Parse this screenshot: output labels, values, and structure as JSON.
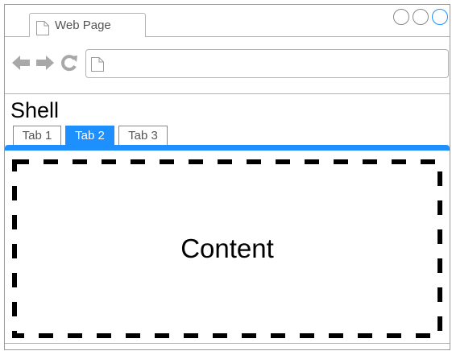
{
  "browser": {
    "tab_title": "Web Page",
    "address_value": "",
    "accent_color": "#1e8fff"
  },
  "icons": {
    "page": "page-icon",
    "back": "arrow-left-icon",
    "forward": "arrow-right-icon",
    "reload": "reload-icon"
  },
  "shell": {
    "title": "Shell",
    "tabs": [
      {
        "label": "Tab 1",
        "selected": false
      },
      {
        "label": "Tab 2",
        "selected": true
      },
      {
        "label": "Tab 3",
        "selected": false
      }
    ]
  },
  "content": {
    "label": "Content"
  }
}
